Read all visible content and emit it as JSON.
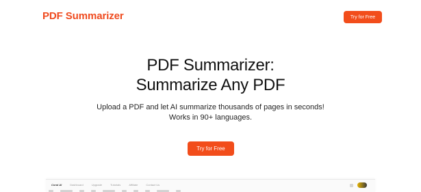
{
  "header": {
    "logo": "PDF Summarizer",
    "cta_label": "Try for Free"
  },
  "hero": {
    "title_line1": "PDF Summarizer:",
    "title_line2": "Summarize Any PDF",
    "sub_line1": "Upload a PDF and let AI summarize thousands of pages in seconds!",
    "sub_line2": "Works in 90+ languages.",
    "cta_label": "Try for Free"
  },
  "preview": {
    "brand": "Coral AI",
    "nav": [
      "Dashboard",
      "Upgrade",
      "Tutorials",
      "Affiliate",
      "Contact Us"
    ]
  },
  "colors": {
    "accent": "#f24d1b",
    "logo": "#ef4a1e"
  }
}
